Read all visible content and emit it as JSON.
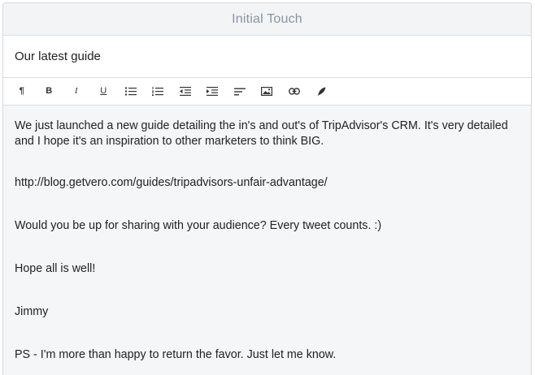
{
  "header": {
    "title": "Initial Touch"
  },
  "subject": {
    "value": "Our latest guide"
  },
  "toolbar": {
    "buttons": [
      {
        "name": "paragraph",
        "icon": "paragraph-icon",
        "glyph": "¶"
      },
      {
        "name": "bold",
        "icon": "bold-icon",
        "glyph": "B"
      },
      {
        "name": "italic",
        "icon": "italic-icon",
        "glyph": "I"
      },
      {
        "name": "underline",
        "icon": "underline-icon",
        "glyph": "U"
      },
      {
        "name": "bulleted-list",
        "icon": "bulleted-list-icon"
      },
      {
        "name": "numbered-list",
        "icon": "numbered-list-icon"
      },
      {
        "name": "outdent",
        "icon": "outdent-icon"
      },
      {
        "name": "indent",
        "icon": "indent-icon"
      },
      {
        "name": "align",
        "icon": "align-left-icon"
      },
      {
        "name": "image",
        "icon": "image-icon"
      },
      {
        "name": "link",
        "icon": "link-icon"
      },
      {
        "name": "pen",
        "icon": "pen-icon"
      }
    ]
  },
  "message": {
    "paragraphs": [
      "We just launched a new guide detailing the in's and out's of TripAdvisor's CRM. It's very detailed and I hope it's an inspiration to other marketers to think BIG.",
      "http://blog.getvero.com/guides/tripadvisors-unfair-advantage/",
      "Would you be up for sharing with your audience? Every tweet counts. :)",
      "Hope all is well!",
      "Jimmy",
      "PS - I'm more than happy to return the favor. Just let me know."
    ]
  },
  "colors": {
    "header_bg": "#f2f4f6",
    "header_text": "#8a949e",
    "body_bg": "#f4f6f8",
    "border": "#dadde0",
    "text": "#222222"
  }
}
